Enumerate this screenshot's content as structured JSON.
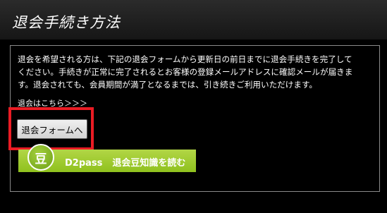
{
  "header": {
    "title": "退会手続き方法"
  },
  "panel": {
    "description_lines": [
      "退会を希望される方は、下記の退会フォームから更新日の前日までに退会手続きを完了して",
      "ください。手続きが正常に完了されるとお客様の登録メールアドレスに確認メールが届きま",
      "す。退会されても、会員期間が満了となるまでは、引き続きご利用いただけます。"
    ],
    "withdraw_link_text": "退会はこちら＞＞＞",
    "withdraw_button_label": "退会フォームへ"
  },
  "banner": {
    "badge_char": "豆",
    "brand": "D2pass",
    "label": "退会豆知識を読む"
  },
  "colors": {
    "highlight_box": "#ea1c24",
    "banner_green": "#9ccb2e",
    "background": "#000000"
  }
}
